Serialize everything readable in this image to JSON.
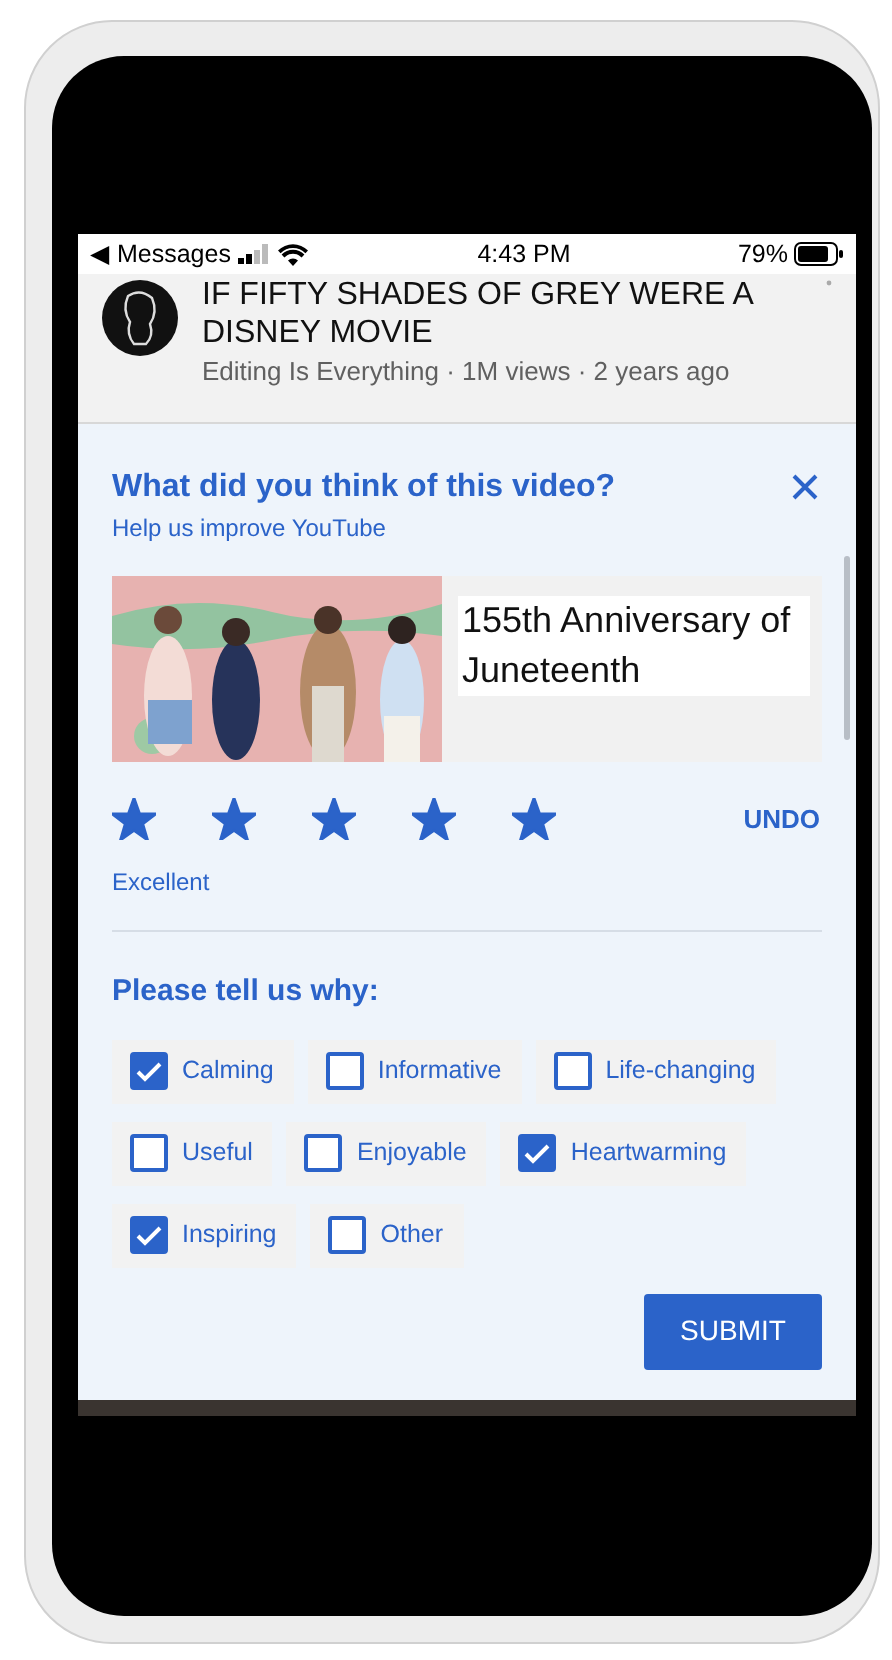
{
  "status_bar": {
    "back_label": "◀ Messages",
    "time": "4:43 PM",
    "battery": "79%"
  },
  "video": {
    "title_lines": [
      "IF FIFTY SHADES OF GREY WERE A",
      "DISNEY MOVIE"
    ],
    "meta": "Editing Is Everything · 1M views · 2 years ago"
  },
  "survey": {
    "question": "What did you think of this video?",
    "subtitle": "Help us improve YouTube",
    "video_title": "155th Anniversary of Juneteenth",
    "stars": 5,
    "rating_label": "Excellent",
    "undo": "UNDO",
    "reasons_heading": "Please tell us why:",
    "reasons": [
      {
        "label": "Calming",
        "checked": true
      },
      {
        "label": "Informative",
        "checked": false
      },
      {
        "label": "Life-changing",
        "checked": false
      },
      {
        "label": "Useful",
        "checked": false
      },
      {
        "label": "Enjoyable",
        "checked": false
      },
      {
        "label": "Heartwarming",
        "checked": true
      },
      {
        "label": "Inspiring",
        "checked": true
      },
      {
        "label": "Other",
        "checked": false
      }
    ],
    "submit": "SUBMIT"
  }
}
